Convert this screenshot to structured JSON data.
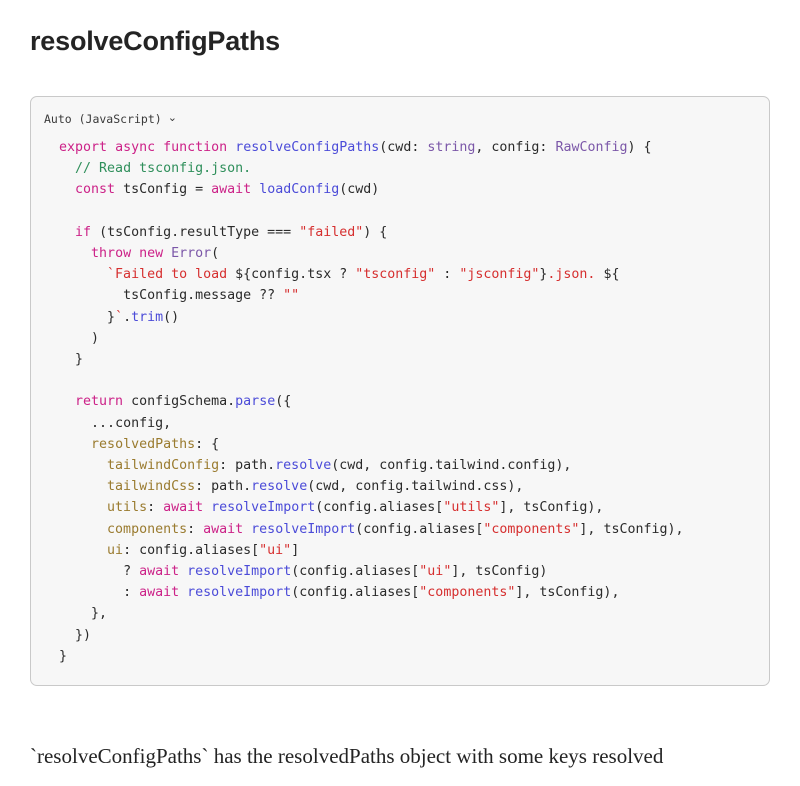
{
  "page": {
    "title": "resolveConfigPaths",
    "footer_text": "`resolveConfigPaths` has the resolvedPaths object with some keys resolved"
  },
  "code_block": {
    "language_label": "Auto (JavaScript)",
    "chevron_icon": "chevron-down-icon",
    "background": "#f7f7f7",
    "border_color": "#c9c9c9",
    "colors": {
      "keyword": "#cc2288",
      "function": "#4b4bd8",
      "type": "#7b57a8",
      "string": "#d62f2f",
      "comment": "#2f8f5b",
      "property_key": "#9a7b2f",
      "plain": "#2a2a2a"
    },
    "lines": [
      "  export async function resolveConfigPaths(cwd: string, config: RawConfig) {",
      "    // Read tsconfig.json.",
      "    const tsConfig = await loadConfig(cwd)",
      "",
      "    if (tsConfig.resultType === \"failed\") {",
      "      throw new Error(",
      "        `Failed to load ${config.tsx ? \"tsconfig\" : \"jsconfig\"}.json. ${",
      "          tsConfig.message ?? \"\"",
      "        }`.trim()",
      "      )",
      "    }",
      "",
      "    return configSchema.parse({",
      "      ...config,",
      "      resolvedPaths: {",
      "        tailwindConfig: path.resolve(cwd, config.tailwind.config),",
      "        tailwindCss: path.resolve(cwd, config.tailwind.css),",
      "        utils: await resolveImport(config.aliases[\"utils\"], tsConfig),",
      "        components: await resolveImport(config.aliases[\"components\"], tsConfig),",
      "        ui: config.aliases[\"ui\"]",
      "          ? await resolveImport(config.aliases[\"ui\"], tsConfig)",
      "          : await resolveImport(config.aliases[\"components\"], tsConfig),",
      "      },",
      "    })",
      "  }"
    ]
  }
}
